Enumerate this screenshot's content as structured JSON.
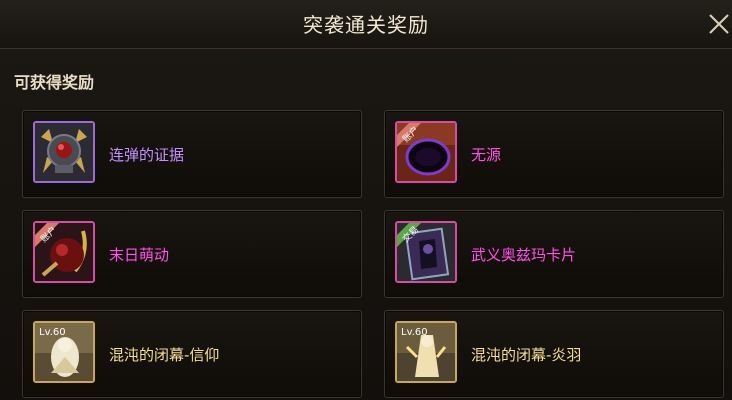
{
  "header": {
    "title": "突袭通关奖励",
    "close_icon": "close-icon"
  },
  "section": {
    "title": "可获得奖励"
  },
  "rewards": [
    {
      "name": "连弹的证据",
      "icon": "orb-relic-icon",
      "color": "#c490ff"
    },
    {
      "name": "无源",
      "icon": "dark-portal-icon",
      "badge": "账户",
      "color": "#ff52e8"
    },
    {
      "name": "末日萌动",
      "icon": "doom-orb-icon",
      "badge": "账户",
      "color": "#ff52e8"
    },
    {
      "name": "武义奥兹玛卡片",
      "icon": "ozma-card-icon",
      "badge": "交易",
      "color": "#ff52e8"
    },
    {
      "name": "混沌的闭幕-信仰",
      "icon": "chaos-faith-icon",
      "level": "Lv.60",
      "color": "#f5df95"
    },
    {
      "name": "混沌的闭幕-炎羽",
      "icon": "chaos-flame-icon",
      "level": "Lv.60",
      "color": "#f5df95"
    }
  ]
}
